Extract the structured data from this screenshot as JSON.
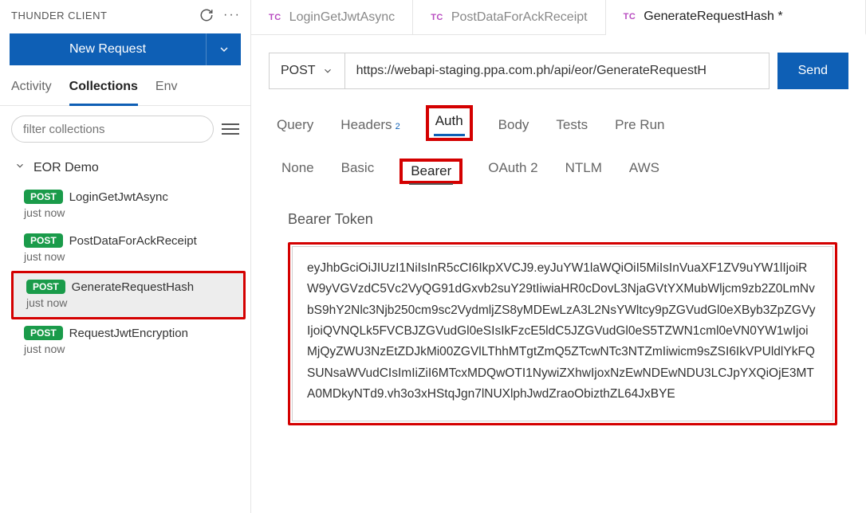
{
  "sidebar": {
    "title": "THUNDER CLIENT",
    "new_request": "New Request",
    "tabs": {
      "activity": "Activity",
      "collections": "Collections",
      "env": "Env"
    },
    "filter_placeholder": "filter collections",
    "collection_name": "EOR Demo",
    "requests": [
      {
        "method": "POST",
        "name": "LoginGetJwtAsync",
        "time": "just now"
      },
      {
        "method": "POST",
        "name": "PostDataForAckReceipt",
        "time": "just now"
      },
      {
        "method": "POST",
        "name": "GenerateRequestHash",
        "time": "just now"
      },
      {
        "method": "POST",
        "name": "RequestJwtEncryption",
        "time": "just now"
      }
    ]
  },
  "editor_tabs": [
    {
      "prefix": "TC",
      "label": "LoginGetJwtAsync",
      "dirty": false
    },
    {
      "prefix": "TC",
      "label": "PostDataForAckReceipt",
      "dirty": false
    },
    {
      "prefix": "TC",
      "label": "GenerateRequestHash",
      "dirty": true
    }
  ],
  "request": {
    "method": "POST",
    "url": "https://webapi-staging.ppa.com.ph/api/eor/GenerateRequestH",
    "send": "Send"
  },
  "sub_tabs": {
    "query": "Query",
    "headers": "Headers",
    "headers_count": "2",
    "auth": "Auth",
    "body": "Body",
    "tests": "Tests",
    "prerun": "Pre Run"
  },
  "auth_types": {
    "none": "None",
    "basic": "Basic",
    "bearer": "Bearer",
    "oauth2": "OAuth 2",
    "ntlm": "NTLM",
    "aws": "AWS"
  },
  "token": {
    "label": "Bearer Token",
    "value": "eyJhbGciOiJIUzI1NiIsInR5cCI6IkpXVCJ9.eyJuYW1laWQiOiI5MiIsInVuaXF1ZV9uYW1lIjoiRW9yVGVzdC5Vc2VyQG91dGxvb2suY29tIiwiaHR0cDovL3NjaGVtYXMubWljcm9zb2Z0LmNvbS9hY2Nlc3Njb250cm9sc2VydmljZS8yMDEwLzA3L2NsYWltcy9pZGVudGl0eXByb3ZpZGVyIjoiQVNQLk5FVCBJZGVudGl0eSIsIkFzcE5ldC5JZGVudGl0eS5TZWN1cml0eVN0YW1wIjoiMjQyZWU3NzEtZDJkMi00ZGVlLThhMTgtZmQ5ZTcwNTc3NTZmIiwicm9sZSI6IkVPUldlYkFQSUNsaWVudCIsImIiZiI6MTcxMDQwOTI1NywiZXhwIjoxNzEwNDEwNDU3LCJpYXQiOjE3MTA0MDkyNTd9.vh3o3xHStqJgn7lNUXlphJwdZraoObizthZL64JxBYE"
  }
}
